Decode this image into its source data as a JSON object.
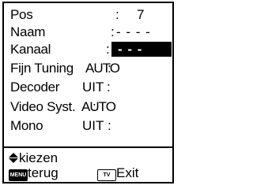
{
  "menu": {
    "rows": [
      {
        "label": "Pos",
        "colon": ":",
        "value": "7"
      },
      {
        "label": "Naam",
        "colon": ":",
        "value": "- - - -"
      },
      {
        "label": "Kanaal",
        "colon": ":",
        "value": "- - -"
      },
      {
        "label": "Fijn Tuning",
        "colon": ":",
        "value": "AUTO"
      },
      {
        "label": "Decoder",
        "colon": ":",
        "value": "UIT"
      },
      {
        "label": "Video Syst.",
        "colon": ":",
        "value": "AUTO"
      },
      {
        "label": "Mono",
        "colon": ":",
        "value": "UIT"
      }
    ]
  },
  "footer": {
    "select_label": "kiezen",
    "back_key": "MENU",
    "back_label": "terug",
    "exit_key": "TV",
    "exit_label": "Exit"
  },
  "icons": {
    "select": "up-down-arrow-icon",
    "back": "menu-key-icon",
    "exit": "tv-key-icon"
  },
  "colors": {
    "background": "#ffffff",
    "text": "#000000",
    "highlight": "#000000",
    "highlight_text": "#ffffff"
  }
}
